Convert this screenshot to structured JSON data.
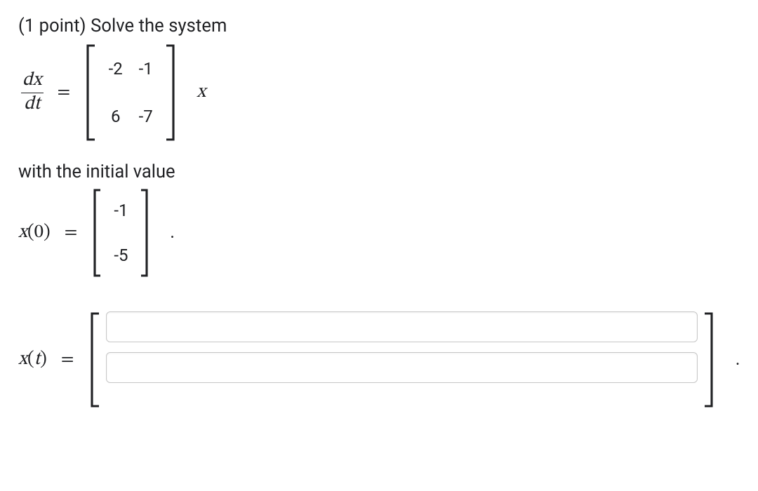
{
  "prompt": {
    "points_prefix": "(1 point) ",
    "text": "Solve the system"
  },
  "equation1": {
    "lhs_num": "dx",
    "lhs_den": "dt",
    "equals": "=",
    "matrix": [
      [
        "-2",
        "-1"
      ],
      [
        "6",
        "-7"
      ]
    ],
    "rhs_var": "x"
  },
  "sub_prompt": "with the initial value",
  "initial_value": {
    "lhs": "x(0)",
    "equals": "=",
    "vector": [
      "-1",
      "-5"
    ],
    "trailing": "."
  },
  "answer": {
    "lhs": "x(t)",
    "equals": "=",
    "field1_value": "",
    "field2_value": "",
    "trailing": "."
  }
}
